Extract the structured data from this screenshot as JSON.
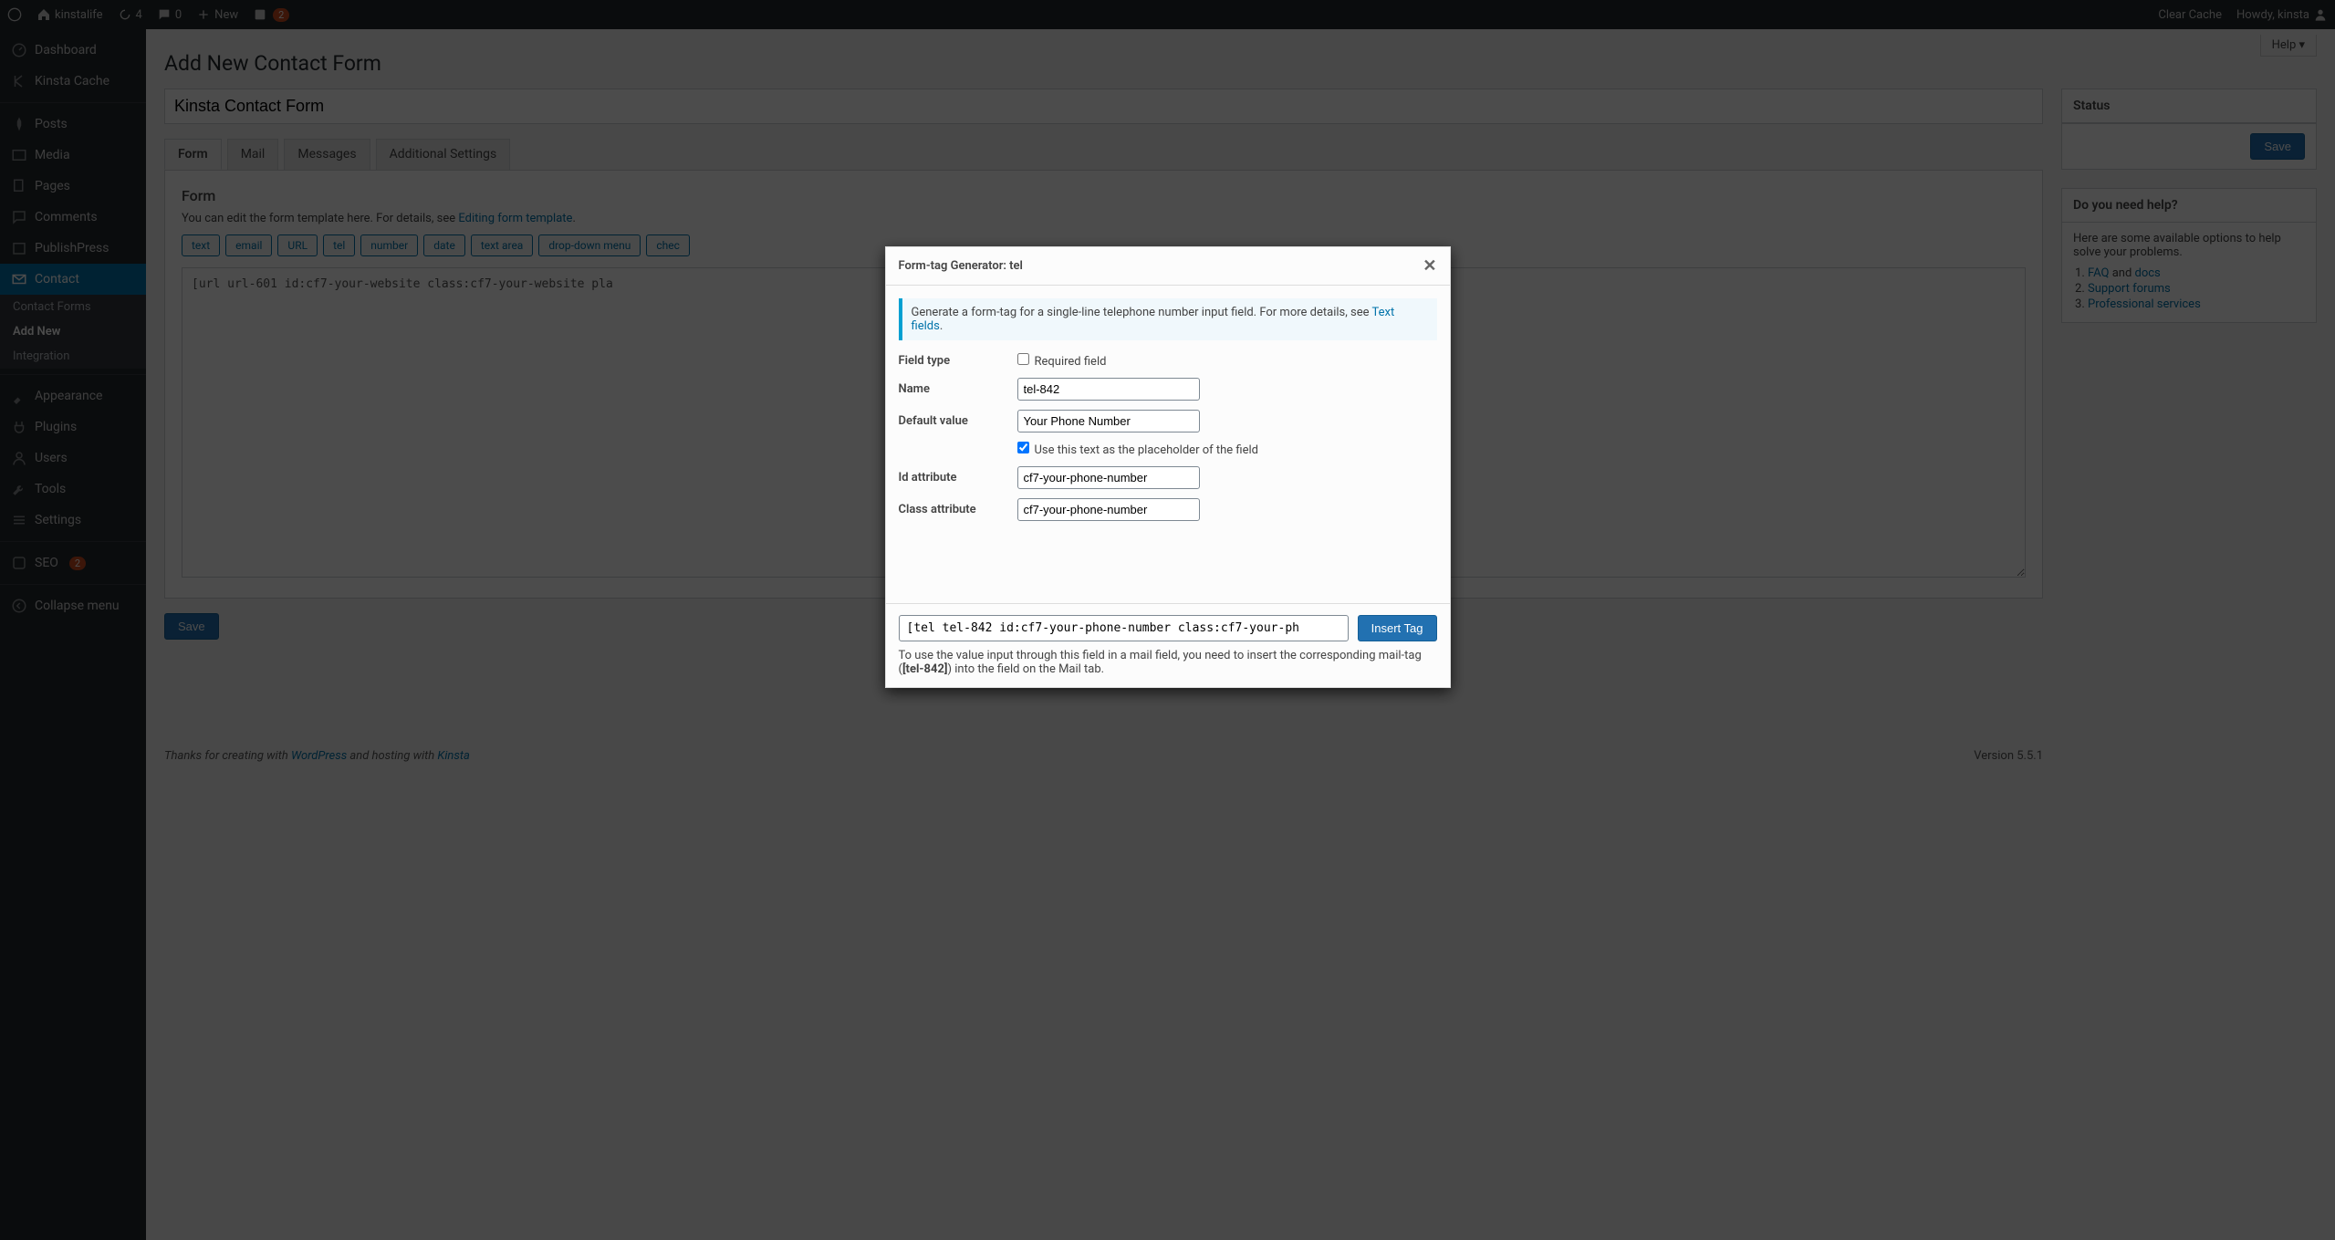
{
  "adminbar": {
    "site_name": "kinstalife",
    "updates_count": "4",
    "comments_count": "0",
    "new_label": "New",
    "yoast_count": "2",
    "clear_cache": "Clear Cache",
    "greeting": "Howdy, kinsta"
  },
  "sidebar": {
    "dashboard": "Dashboard",
    "kinsta_cache": "Kinsta Cache",
    "posts": "Posts",
    "media": "Media",
    "pages": "Pages",
    "comments": "Comments",
    "publishpress": "PublishPress",
    "contact": "Contact",
    "contact_sub": {
      "forms": "Contact Forms",
      "add_new": "Add New",
      "integration": "Integration"
    },
    "appearance": "Appearance",
    "plugins": "Plugins",
    "users": "Users",
    "tools": "Tools",
    "settings": "Settings",
    "seo": "SEO",
    "seo_count": "2",
    "collapse": "Collapse menu"
  },
  "page": {
    "help": "Help",
    "title": "Add New Contact Form",
    "form_title_value": "Kinsta Contact Form",
    "tabs": {
      "form": "Form",
      "mail": "Mail",
      "messages": "Messages",
      "addl": "Additional Settings"
    },
    "form_panel": {
      "heading": "Form",
      "hint_pre": "You can edit the form template here. For details, see ",
      "hint_link": "Editing form template",
      "tags": [
        "text",
        "email",
        "URL",
        "tel",
        "number",
        "date",
        "text area",
        "drop-down menu",
        "chec"
      ],
      "textarea": "[url url-601 id:cf7-your-website class:cf7-your-website pla"
    },
    "save": "Save"
  },
  "side": {
    "status": {
      "title": "Status",
      "save": "Save"
    },
    "help": {
      "title": "Do you need help?",
      "intro": "Here are some available options to help solve your problems.",
      "faq": "FAQ",
      "and": " and ",
      "docs": "docs",
      "support": "Support forums",
      "services": "Professional services"
    }
  },
  "footer": {
    "pre": "Thanks for creating with ",
    "wp": "WordPress",
    "mid": " and hosting with ",
    "kinsta": "Kinsta",
    "version": "Version 5.5.1"
  },
  "modal": {
    "title": "Form-tag Generator: tel",
    "note_pre": "Generate a form-tag for a single-line telephone number input field. For more details, see ",
    "note_link": "Text fields",
    "fields": {
      "type_label": "Field type",
      "required_label": "Required field",
      "name_label": "Name",
      "name_value": "tel-842",
      "default_label": "Default value",
      "default_value": "Your Phone Number",
      "placeholder_label": "Use this text as the placeholder of the field",
      "id_label": "Id attribute",
      "id_value": "cf7-your-phone-number",
      "class_label": "Class attribute",
      "class_value": "cf7-your-phone-number"
    },
    "shortcode": "[tel tel-842 id:cf7-your-phone-number class:cf7-your-ph",
    "insert": "Insert Tag",
    "foot_pre": "To use the value input through this field in a mail field, you need to insert the corresponding mail-tag (",
    "foot_tag": "[tel-842]",
    "foot_post": ") into the field on the Mail tab."
  }
}
